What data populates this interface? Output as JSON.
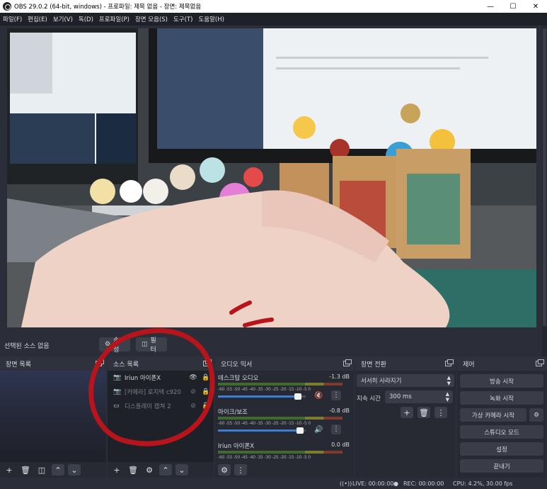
{
  "window": {
    "title": "OBS 29.0.2 (64-bit, windows) - 프로파일: 제목 없음 - 장면: 제목없음",
    "minimize_icon": "minimize-icon",
    "maximize_icon": "maximize-icon",
    "close_icon": "close-icon"
  },
  "menu": [
    "파일(F)",
    "편집(E)",
    "보기(V)",
    "독(D)",
    "프로파일(P)",
    "장면 모음(S)",
    "도구(T)",
    "도움말(H)"
  ],
  "context_bar": {
    "label": "선택된 소스 없음",
    "properties_label": "속성",
    "filters_label": "필터"
  },
  "scenes": {
    "title": "장면 목록"
  },
  "sources": {
    "title": "소스 목록",
    "items": [
      {
        "name": "Iriun 아이폰X",
        "icon": "camera-icon",
        "visible": true
      },
      {
        "name": "[카메라] 로지텍 c920",
        "icon": "camera-icon",
        "visible": false
      },
      {
        "name": "디스플레이 캡쳐 2",
        "icon": "monitor-icon",
        "visible": false
      }
    ]
  },
  "mixer": {
    "title": "오디오 믹서",
    "ticks": "-60 -55 -50 -45 -40 -35 -30 -25 -20 -15 -10 -5 0",
    "channels": [
      {
        "name": "데스크탑 오디오",
        "db": "-1.3 dB",
        "volume": 0.95,
        "muted": true
      },
      {
        "name": "마이크/보조",
        "db": "-0.8 dB",
        "volume": 0.97,
        "muted": false
      },
      {
        "name": "Iriun 아이폰X",
        "db": "0.0 dB",
        "volume": 1.0,
        "muted": false
      }
    ]
  },
  "transitions": {
    "title": "장면 전환",
    "selected": "서서히 사라지기",
    "duration_label": "지속 시간",
    "duration_value": "300 ms"
  },
  "controls": {
    "title": "제어",
    "buttons": [
      "방송 시작",
      "녹화 시작",
      "가상 카메라 시작",
      "스튜디오 모드",
      "설정",
      "끝내기"
    ]
  },
  "status": {
    "live": "LIVE: 00:00:00",
    "rec": "REC: 00:00:00",
    "cpu": "CPU: 4.2%, 30.00 fps"
  },
  "colors": {
    "annotation_red": "#b8141c",
    "accent_blue": "#3d7ed4"
  }
}
